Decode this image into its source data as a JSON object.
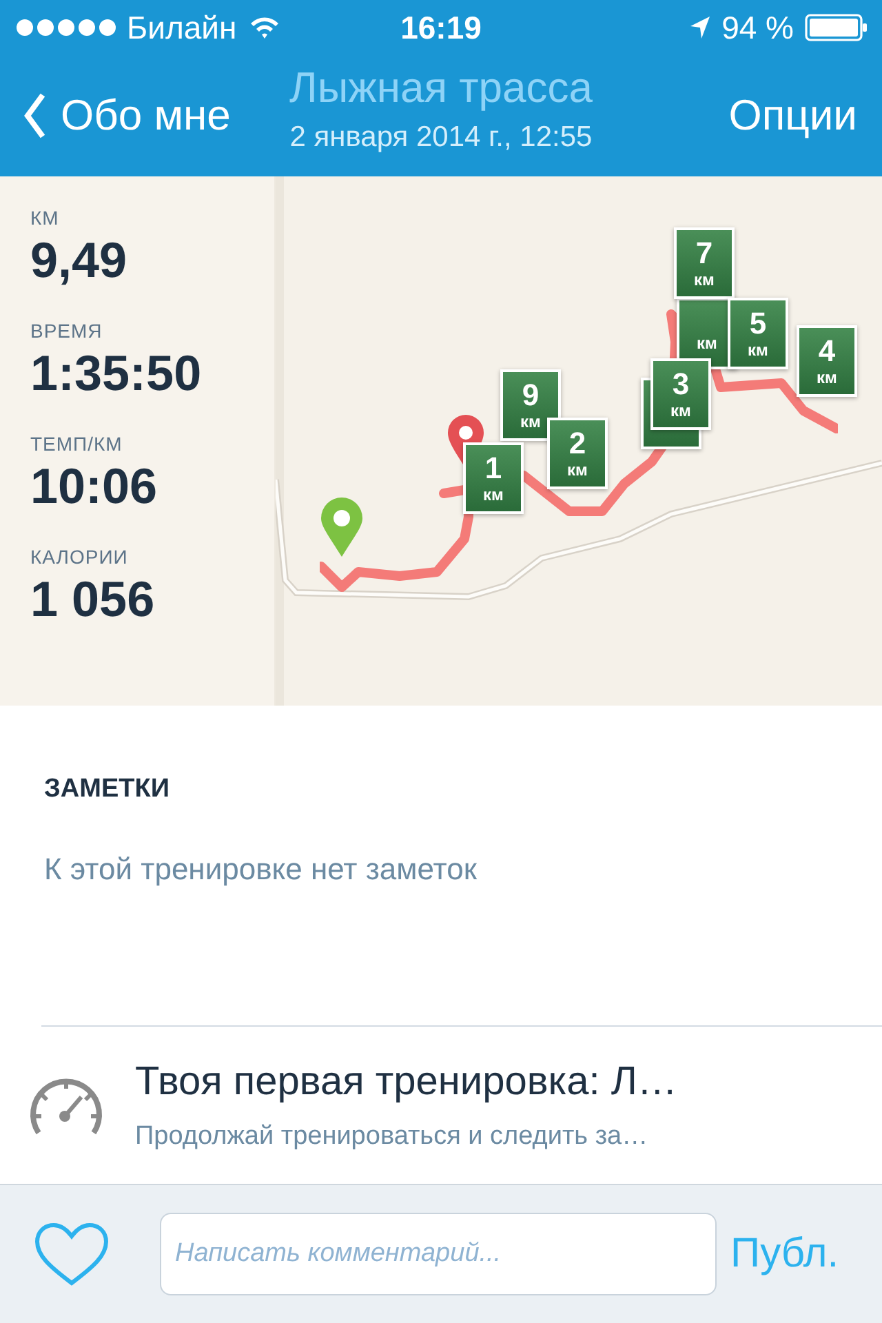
{
  "status_bar": {
    "carrier": "Билайн",
    "time": "16:19",
    "battery": "94 %"
  },
  "nav": {
    "back": "Обо мне",
    "title": "Лыжная трасса",
    "subtitle": "2 января 2014 г., 12:55",
    "action": "Опции"
  },
  "stats": [
    {
      "label": "КМ",
      "value": "9,49"
    },
    {
      "label": "ВРЕМЯ",
      "value": "1:35:50"
    },
    {
      "label": "ТЕМП/КМ",
      "value": "10:06"
    },
    {
      "label": "КАЛОРИИ",
      "value": "1 056"
    }
  ],
  "map": {
    "kind": "picture",
    "markers": [
      {
        "kind": "covered"
      },
      {
        "kind": "partial",
        "unit": "км"
      },
      {
        "kind": "full",
        "number": "7",
        "unit": "км"
      },
      {
        "kind": "full",
        "number": "5",
        "unit": "км"
      },
      {
        "kind": "full",
        "number": "4",
        "unit": "км"
      },
      {
        "kind": "full",
        "number": "3",
        "unit": "км"
      },
      {
        "kind": "full",
        "number": "9",
        "unit": "км"
      },
      {
        "kind": "full",
        "number": "2",
        "unit": "км"
      },
      {
        "kind": "full",
        "number": "1",
        "unit": "км"
      }
    ]
  },
  "notes": {
    "heading": "ЗАМЕТКИ",
    "text": "К этой тренировке нет заметок"
  },
  "achievement": {
    "title": "Твоя первая тренировка: Л…",
    "subtitle": "Продолжай тренироваться и следить за…"
  },
  "comment_bar": {
    "liked": false,
    "placeholder": "Написать комментарий...",
    "post": "Публ."
  }
}
